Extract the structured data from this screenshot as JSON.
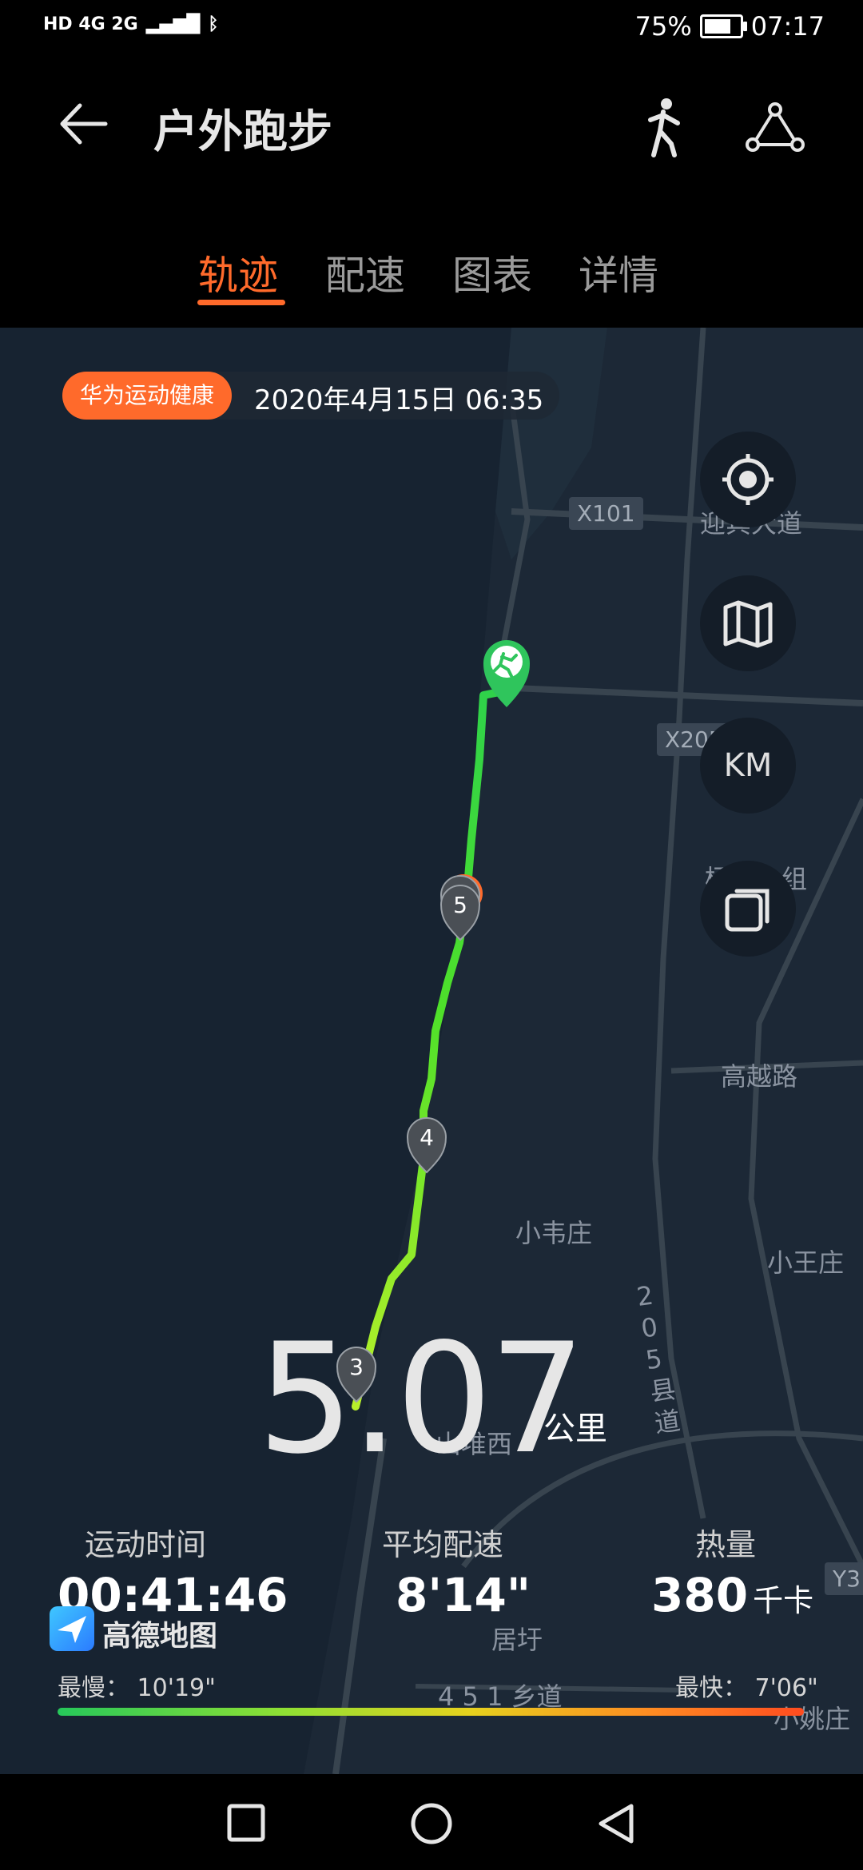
{
  "status": {
    "battery": "75%",
    "time": "07:17",
    "network_left": "HD 4G 2G"
  },
  "appbar": {
    "title": "户外跑步"
  },
  "tabs": [
    "轨迹",
    "配速",
    "图表",
    "详情"
  ],
  "map": {
    "brand": "华为运动健康",
    "datetime": "2020年4月15日 06:35",
    "controls": {
      "km_label": "KM"
    },
    "road_badges": [
      "X101",
      "X205"
    ],
    "labels": [
      "迎宾大道",
      "杨码八组",
      "高越路",
      "小韦庄",
      "小王庄",
      "山堆西",
      "居圩",
      "小姚庄",
      "Y3"
    ],
    "vertical_label": "205县道",
    "bottom_road": "4 5 1 乡道",
    "km_markers": [
      "1",
      "5",
      "4",
      "3"
    ]
  },
  "summary": {
    "distance": "5.07",
    "distance_unit": "公里",
    "time_label": "运动时间",
    "time_value": "00:41:46",
    "pace_label": "平均配速",
    "pace_value": "8'14\"",
    "calorie_label": "热量",
    "calorie_value": "380",
    "calorie_unit": "千卡"
  },
  "amap": {
    "name": "高德地图"
  },
  "pace_scale": {
    "slowest": "最慢：  10'19\"",
    "fastest": "最快：  7'06\""
  },
  "colors": {
    "accent": "#ff6a2b",
    "track_start": "#26c85a",
    "track_end": "#b8f02a"
  }
}
